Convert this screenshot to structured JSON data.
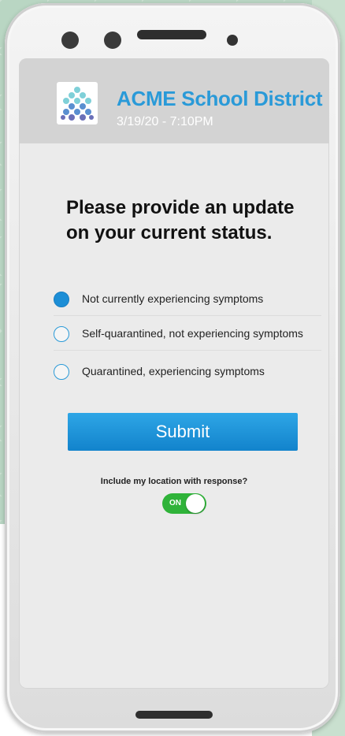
{
  "app": {
    "name": "ACME School District",
    "timestamp": "3/19/20 - 7:10PM",
    "logo_icon": "dots-logo-icon"
  },
  "survey": {
    "question": "Please provide an update on your current status.",
    "options": [
      {
        "label": "Not currently experiencing symptoms",
        "selected": true
      },
      {
        "label": "Self-quarantined, not experiencing symptoms",
        "selected": false
      },
      {
        "label": "Quarantined, experiencing symptoms",
        "selected": false
      }
    ],
    "submit_label": "Submit"
  },
  "location": {
    "label": "Include my location with response?",
    "toggle_text": "ON",
    "enabled": true
  },
  "colors": {
    "accent": "#2a9ad8",
    "toggle_on": "#2fb339",
    "header_bg": "#d3d3d3"
  }
}
